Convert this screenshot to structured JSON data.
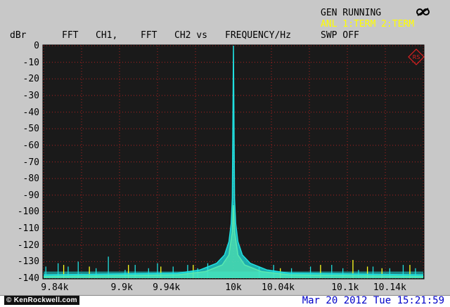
{
  "header": {
    "gen_status": "GEN RUNNING",
    "anl_status": "ANL 1:TERM 2:TERM",
    "sweep_status": "SWP OFF",
    "title_items": [
      "dBr",
      "FFT",
      "CH1,",
      "FFT",
      "CH2 vs",
      "FREQUENCY/Hz"
    ]
  },
  "footer": {
    "watermark": "© KenRockwell.com",
    "datetime": "Mar 20 2012 Tue 15:21:59"
  },
  "icons": {
    "top_right": "sweep-link-icon",
    "logo": "rohde-schwarz-logo-icon"
  },
  "colors": {
    "background": "#c8c8c8",
    "plot_bg": "#1a1a1a",
    "grid": "#b02020",
    "trace_ch1": "#ffff20",
    "trace_ch2": "#20e0e0",
    "status_yellow": "#ffff00",
    "date_blue": "#0000c8"
  },
  "chart_data": {
    "type": "line",
    "title": "FFT CH1, FFT CH2 vs FREQUENCY/Hz",
    "ylabel": "dBr",
    "xlabel": "FREQUENCY/Hz",
    "ylim": [
      -140,
      0
    ],
    "xlim": [
      9830,
      10170
    ],
    "grid": true,
    "y_ticks": [
      "0",
      "-10",
      "-20",
      "-30",
      "-40",
      "-50",
      "-60",
      "-70",
      "-80",
      "-90",
      "-100",
      "-110",
      "-120",
      "-130",
      "-140"
    ],
    "y_tick_values": [
      0,
      -10,
      -20,
      -30,
      -40,
      -50,
      -60,
      -70,
      -80,
      -90,
      -100,
      -110,
      -120,
      -130,
      -140
    ],
    "x_ticks": [
      "9.84k",
      "9.9k",
      "9.94k",
      "10k",
      "10.04k",
      "10.1k",
      "10.14k"
    ],
    "x_tick_values": [
      9840,
      9900,
      9940,
      10000,
      10040,
      10100,
      10140
    ],
    "series": [
      {
        "color": "#20e0e0",
        "x": [
          9830,
          9950,
          9970,
          9985,
          9992,
          9996,
          9998,
          9999,
          10000,
          10001,
          10002,
          10004,
          10008,
          10015,
          10030,
          10050,
          10170
        ],
        "y": [
          -138,
          -137,
          -135,
          -131,
          -126,
          -118,
          -107,
          -92,
          0,
          -92,
          -107,
          -118,
          -126,
          -131,
          -135,
          -137,
          -138
        ]
      },
      {
        "color": "#ffff20",
        "x": [
          9830,
          9950,
          9975,
          9990,
          9996,
          9999,
          10000,
          10001,
          10004,
          10010,
          10025,
          10050,
          10170
        ],
        "y": [
          -139,
          -138,
          -136,
          -132,
          -126,
          -112,
          -96,
          -112,
          -126,
          -132,
          -136,
          -138,
          -139
        ]
      }
    ],
    "spurs_ch2": [
      {
        "x": 9832,
        "y": -133
      },
      {
        "x": 9843,
        "y": -131
      },
      {
        "x": 9852,
        "y": -133
      },
      {
        "x": 9861,
        "y": -130
      },
      {
        "x": 9877,
        "y": -134
      },
      {
        "x": 9888,
        "y": -127
      },
      {
        "x": 9903,
        "y": -135
      },
      {
        "x": 9912,
        "y": -132
      },
      {
        "x": 9924,
        "y": -134
      },
      {
        "x": 9932,
        "y": -131
      },
      {
        "x": 9946,
        "y": -133
      },
      {
        "x": 9959,
        "y": -132
      },
      {
        "x": 9968,
        "y": -134
      },
      {
        "x": 9977,
        "y": -131
      },
      {
        "x": 10023,
        "y": -133
      },
      {
        "x": 10036,
        "y": -132
      },
      {
        "x": 10052,
        "y": -134
      },
      {
        "x": 10069,
        "y": -133
      },
      {
        "x": 10088,
        "y": -132
      },
      {
        "x": 10098,
        "y": -134
      },
      {
        "x": 10112,
        "y": -135
      },
      {
        "x": 10125,
        "y": -133
      },
      {
        "x": 10140,
        "y": -134
      },
      {
        "x": 10152,
        "y": -132
      },
      {
        "x": 10163,
        "y": -134
      }
    ],
    "spurs_ch1": [
      {
        "x": 9848,
        "y": -132
      },
      {
        "x": 9871,
        "y": -133
      },
      {
        "x": 9906,
        "y": -132
      },
      {
        "x": 9935,
        "y": -133
      },
      {
        "x": 9964,
        "y": -132
      },
      {
        "x": 10042,
        "y": -134
      },
      {
        "x": 10078,
        "y": -132
      },
      {
        "x": 10107,
        "y": -129
      },
      {
        "x": 10120,
        "y": -133
      },
      {
        "x": 10133,
        "y": -134
      },
      {
        "x": 10158,
        "y": -132
      }
    ]
  }
}
